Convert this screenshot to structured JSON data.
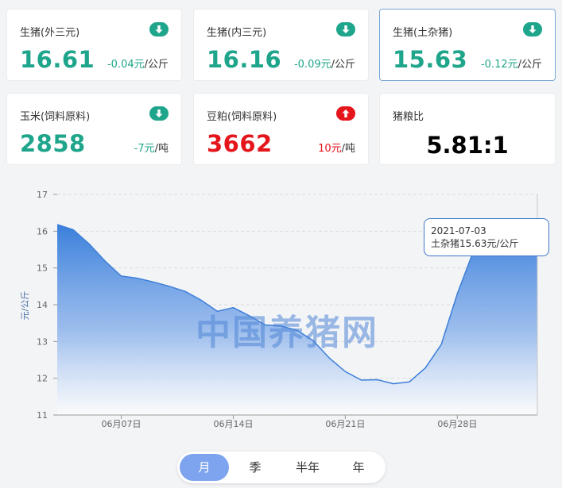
{
  "cards": [
    {
      "name": "生猪(外三元)",
      "price": "16.61",
      "change": "-0.04元",
      "unit": "/公斤",
      "trend": "down",
      "icon": "arrow-down-icon"
    },
    {
      "name": "生猪(内三元)",
      "price": "16.16",
      "change": "-0.09元",
      "unit": "/公斤",
      "trend": "down",
      "icon": "arrow-down-icon"
    },
    {
      "name": "生猪(土杂猪)",
      "price": "15.63",
      "change": "-0.12元",
      "unit": "/公斤",
      "trend": "down",
      "icon": "arrow-down-icon",
      "active": true
    },
    {
      "name": "玉米(饲料原料)",
      "price": "2858",
      "change": "-7元",
      "unit": "/吨",
      "trend": "down",
      "icon": "arrow-down-icon"
    },
    {
      "name": "豆粕(饲料原料)",
      "price": "3662",
      "change": "10元",
      "unit": "/吨",
      "trend": "up",
      "icon": "arrow-up-icon"
    },
    {
      "name": "猪粮比",
      "ratio": "5.81:1"
    }
  ],
  "colors": {
    "down": "#1fa58b",
    "up": "#e4161c",
    "series": "#3d7fd9"
  },
  "chart_data": {
    "type": "area",
    "ylabel": "元/公斤",
    "ylim": [
      11,
      17
    ],
    "yticks": [
      11,
      12,
      13,
      14,
      15,
      16,
      17
    ],
    "xlim": [
      "2021-06-03",
      "2021-07-03"
    ],
    "xticks": [
      "06月07日",
      "06月14日",
      "06月21日",
      "06月28日"
    ],
    "xtick_dates": [
      "2021-06-07",
      "2021-06-14",
      "2021-06-21",
      "2021-06-28"
    ],
    "series": [
      {
        "name": "土杂猪",
        "x": [
          "2021-06-03",
          "2021-06-04",
          "2021-06-05",
          "2021-06-06",
          "2021-06-07",
          "2021-06-08",
          "2021-06-09",
          "2021-06-10",
          "2021-06-11",
          "2021-06-12",
          "2021-06-13",
          "2021-06-14",
          "2021-06-15",
          "2021-06-16",
          "2021-06-17",
          "2021-06-18",
          "2021-06-19",
          "2021-06-20",
          "2021-06-21",
          "2021-06-22",
          "2021-06-23",
          "2021-06-24",
          "2021-06-25",
          "2021-06-26",
          "2021-06-27",
          "2021-06-28",
          "2021-06-29",
          "2021-06-30",
          "2021-07-01",
          "2021-07-02",
          "2021-07-03"
        ],
        "values": [
          16.18,
          16.04,
          15.65,
          15.18,
          14.78,
          14.72,
          14.62,
          14.5,
          14.36,
          14.12,
          13.82,
          13.92,
          13.7,
          13.45,
          13.42,
          13.3,
          13.02,
          12.55,
          12.18,
          11.95,
          11.96,
          11.85,
          11.9,
          12.28,
          12.92,
          14.3,
          15.45,
          15.78,
          15.72,
          15.66,
          15.63
        ]
      }
    ],
    "tooltip": {
      "date": "2021-07-03",
      "text": "土杂猪15.63元/公斤"
    },
    "watermark": "中国养猪网",
    "grid": true
  },
  "tabs": [
    {
      "label": "月",
      "selected": true
    },
    {
      "label": "季",
      "selected": false
    },
    {
      "label": "半年",
      "selected": false
    },
    {
      "label": "年",
      "selected": false
    }
  ]
}
